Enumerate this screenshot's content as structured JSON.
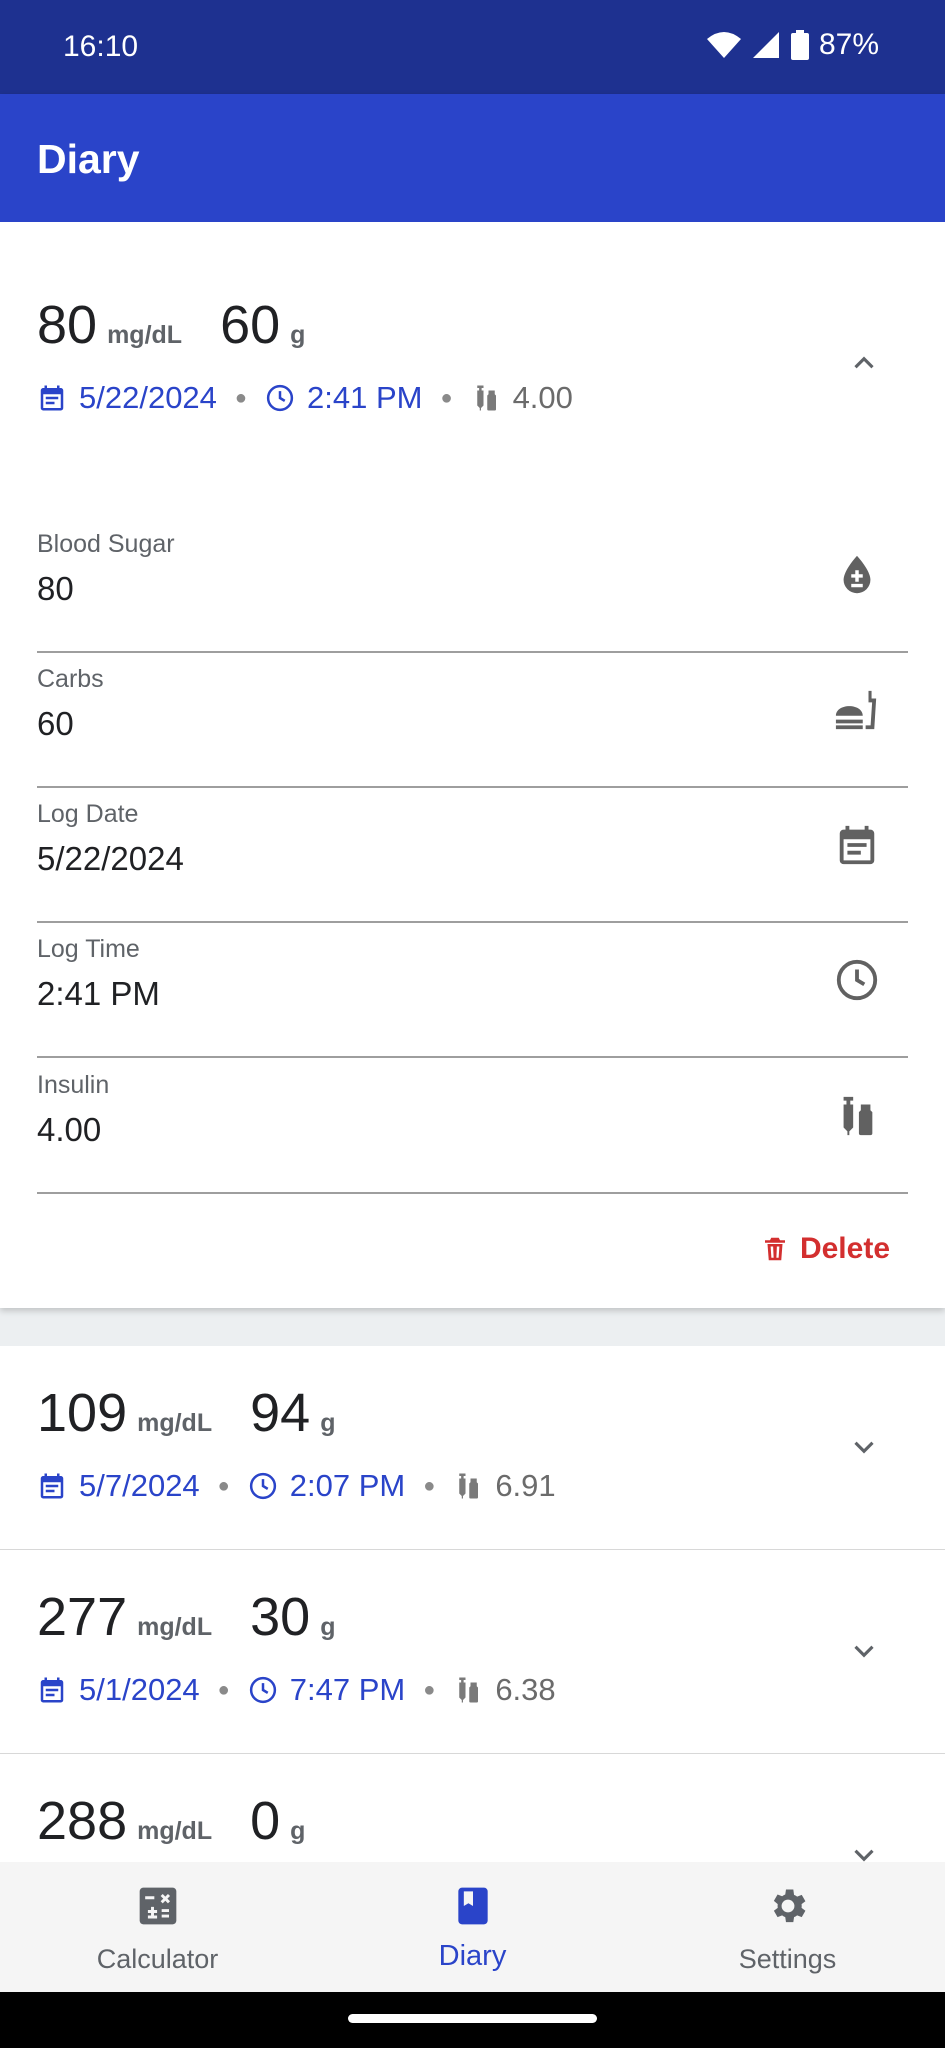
{
  "status_bar": {
    "time": "16:10",
    "battery": "87%"
  },
  "app_bar": {
    "title": "Diary"
  },
  "colors": {
    "primary": "#2a44c9",
    "status_bar": "#1e3190",
    "delete": "#d32f2f"
  },
  "expanded_entry": {
    "blood_sugar": "80",
    "bs_unit": "mg/dL",
    "carbs": "60",
    "carbs_unit": "g",
    "date": "5/22/2024",
    "time": "2:41 PM",
    "insulin": "4.00",
    "fields": [
      {
        "label": "Blood Sugar",
        "value": "80",
        "icon": "blood-drop-icon"
      },
      {
        "label": "Carbs",
        "value": "60",
        "icon": "food-icon"
      },
      {
        "label": "Log Date",
        "value": "5/22/2024",
        "icon": "calendar-icon"
      },
      {
        "label": "Log Time",
        "value": "2:41 PM",
        "icon": "clock-icon"
      },
      {
        "label": "Insulin",
        "value": "4.00",
        "icon": "insulin-icon"
      }
    ],
    "delete_label": "Delete"
  },
  "entries": [
    {
      "blood_sugar": "109",
      "bs_unit": "mg/dL",
      "carbs": "94",
      "carbs_unit": "g",
      "date": "5/7/2024",
      "time": "2:07 PM",
      "insulin": "6.91"
    },
    {
      "blood_sugar": "277",
      "bs_unit": "mg/dL",
      "carbs": "30",
      "carbs_unit": "g",
      "date": "5/1/2024",
      "time": "7:47 PM",
      "insulin": "6.38"
    },
    {
      "blood_sugar": "288",
      "bs_unit": "mg/dL",
      "carbs": "0",
      "carbs_unit": "g"
    }
  ],
  "bottom_nav": [
    {
      "label": "Calculator",
      "icon": "calculator-icon",
      "active": false
    },
    {
      "label": "Diary",
      "icon": "diary-icon",
      "active": true
    },
    {
      "label": "Settings",
      "icon": "gear-icon",
      "active": false
    }
  ]
}
